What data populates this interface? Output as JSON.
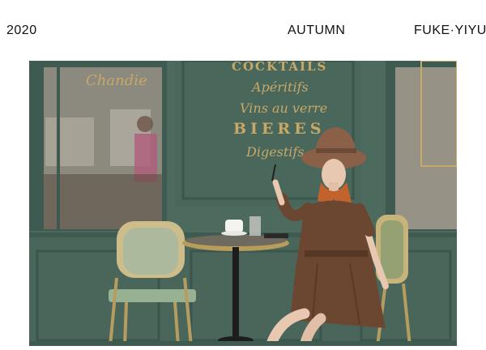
{
  "header": {
    "year": "2020",
    "season": "AUTUMN",
    "brand": "FUKE·YIYU"
  },
  "photo": {
    "window_script": "Chandie",
    "sign_lines": [
      "COCKTAILS",
      "Apéritifs",
      "Vins au verre",
      "BIERES",
      "Digestifs"
    ],
    "colors": {
      "wall": "#4f6a60",
      "gold_lettering": "#c7a867",
      "dress": "#6b4630",
      "hat": "#8a6048"
    }
  }
}
